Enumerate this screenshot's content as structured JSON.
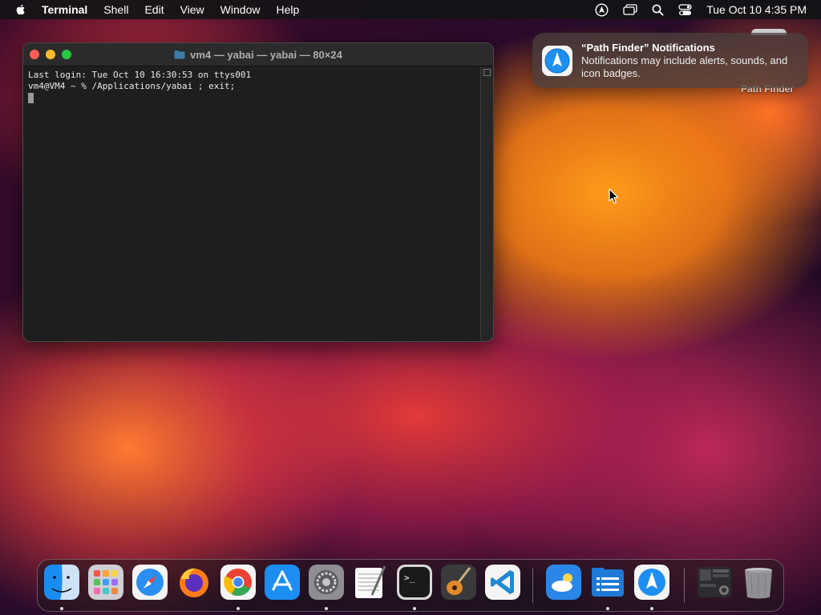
{
  "menubar": {
    "app_name": "Terminal",
    "menus": [
      "Shell",
      "Edit",
      "View",
      "Window",
      "Help"
    ],
    "datetime": "Tue Oct 10  4:35 PM",
    "status_icons": [
      "assistive-icon",
      "screen-mirroring-icon",
      "spotlight-search-icon",
      "control-center-icon"
    ]
  },
  "terminal": {
    "title": "vm4 — yabai — yabai — 80×24",
    "lines": [
      "Last login: Tue Oct 10 16:30:53 on ttys001",
      "vm4@VM4 ~ % /Applications/yabai ; exit;"
    ]
  },
  "notification": {
    "title": "“Path Finder” Notifications",
    "body": "Notifications may include alerts, sounds, and icon badges."
  },
  "desktop": {
    "icon_label": "Path Finder"
  },
  "dock": {
    "items": [
      {
        "name": "finder",
        "running": true
      },
      {
        "name": "launchpad",
        "running": false
      },
      {
        "name": "safari",
        "running": false
      },
      {
        "name": "firefox",
        "running": false
      },
      {
        "name": "chrome",
        "running": true
      },
      {
        "name": "app-store",
        "running": false
      },
      {
        "name": "system-settings",
        "running": true
      },
      {
        "name": "textedit",
        "running": false
      },
      {
        "name": "terminal",
        "running": true
      },
      {
        "name": "garageband",
        "running": false
      },
      {
        "name": "vscode",
        "running": false
      },
      {
        "name": "weather",
        "running": false
      },
      {
        "name": "file-manager",
        "running": true
      },
      {
        "name": "path-finder",
        "running": true
      },
      {
        "name": "downloads-stack",
        "running": false
      },
      {
        "name": "trash",
        "running": false
      }
    ]
  }
}
